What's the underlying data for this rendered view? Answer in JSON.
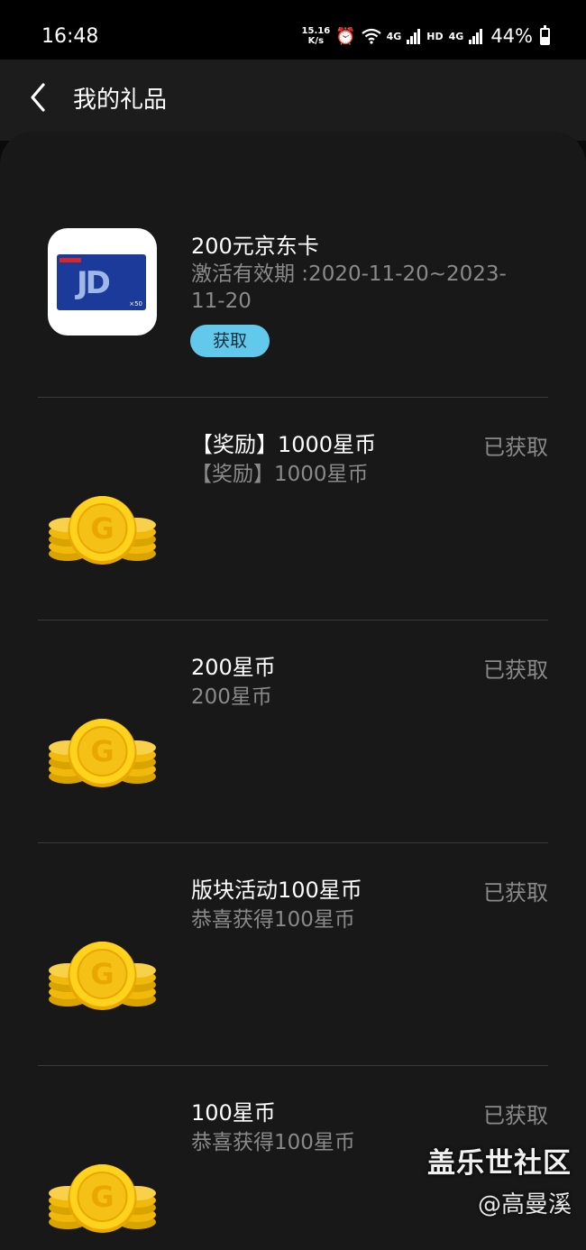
{
  "status_bar": {
    "time": "16:48",
    "net_speed_value": "15.16",
    "net_speed_unit": "K/s",
    "network_4g_a": "4G",
    "hd_label": "HD",
    "network_4g_b": "4G",
    "battery": "44%"
  },
  "header": {
    "title": "我的礼品"
  },
  "items": [
    {
      "title": "200元京东卡",
      "desc": "激活有效期 :2020-11-20~2023-11-20",
      "action_label": "获取",
      "thumb": "jd-card-icon",
      "jd_logo": "JD",
      "jd_amount": "×50"
    },
    {
      "title": "【奖励】1000星币",
      "desc": "【奖励】1000星币",
      "status": "已获取",
      "thumb": "gold-coin-icon"
    },
    {
      "title": "200星币",
      "desc": "200星币",
      "status": "已获取",
      "thumb": "gold-coin-icon"
    },
    {
      "title": "版块活动100星币",
      "desc": "恭喜获得100星币",
      "status": "已获取",
      "thumb": "gold-coin-icon"
    },
    {
      "title": "100星币",
      "desc": "恭喜获得100星币",
      "status": "已获取",
      "thumb": "gold-coin-icon"
    }
  ],
  "watermark": {
    "line1": "盖乐世社区",
    "line2": "@高曼溪"
  },
  "colors": {
    "accent": "#63c9ec",
    "coin": "#f5c518",
    "background": "#181818"
  }
}
